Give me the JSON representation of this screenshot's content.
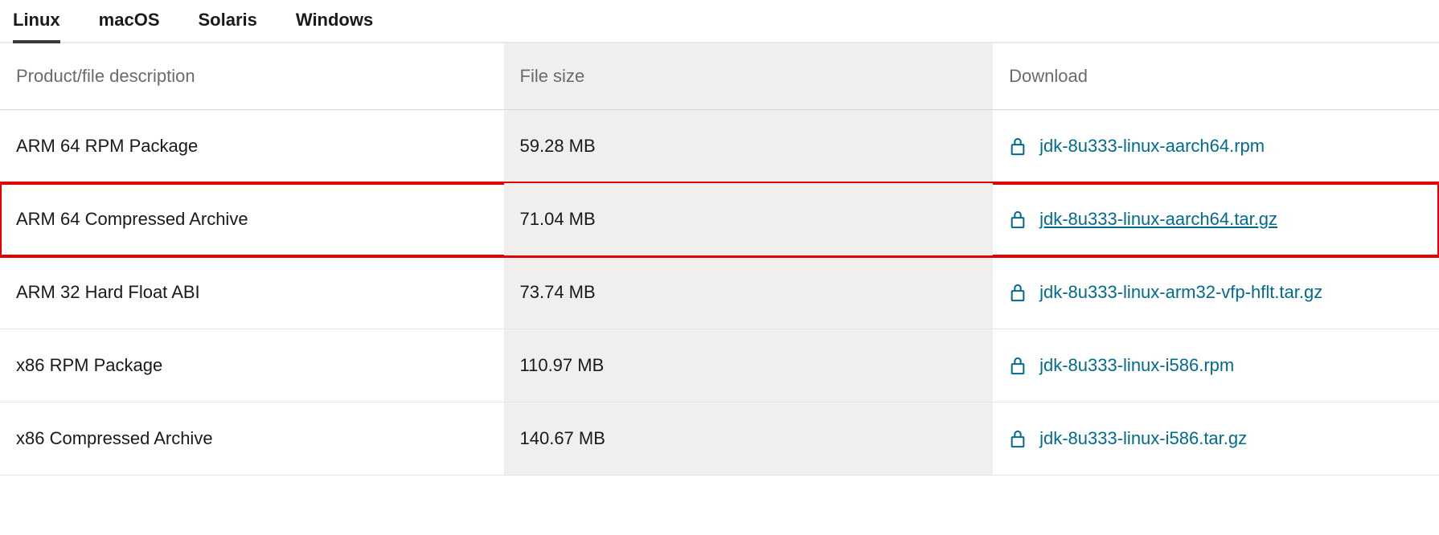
{
  "tabs": [
    {
      "label": "Linux",
      "active": true
    },
    {
      "label": "macOS",
      "active": false
    },
    {
      "label": "Solaris",
      "active": false
    },
    {
      "label": "Windows",
      "active": false
    }
  ],
  "columns": {
    "description": "Product/file description",
    "filesize": "File size",
    "download": "Download"
  },
  "rows": [
    {
      "description": "ARM 64 RPM Package",
      "filesize": "59.28 MB",
      "filename": "jdk-8u333-linux-aarch64.rpm",
      "highlighted": false,
      "underlined": false
    },
    {
      "description": "ARM 64 Compressed Archive",
      "filesize": "71.04 MB",
      "filename": "jdk-8u333-linux-aarch64.tar.gz",
      "highlighted": true,
      "underlined": true
    },
    {
      "description": "ARM 32 Hard Float ABI",
      "filesize": "73.74 MB",
      "filename": "jdk-8u333-linux-arm32-vfp-hflt.tar.gz",
      "highlighted": false,
      "underlined": false
    },
    {
      "description": "x86 RPM Package",
      "filesize": "110.97 MB",
      "filename": "jdk-8u333-linux-i586.rpm",
      "highlighted": false,
      "underlined": false
    },
    {
      "description": "x86 Compressed Archive",
      "filesize": "140.67 MB",
      "filename": "jdk-8u333-linux-i586.tar.gz",
      "highlighted": false,
      "underlined": false
    }
  ]
}
